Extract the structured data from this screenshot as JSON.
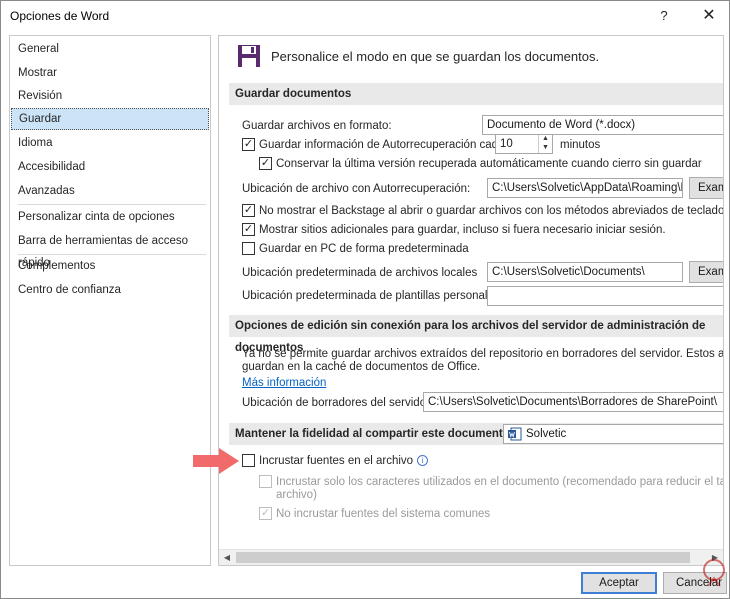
{
  "window": {
    "title": "Opciones de Word",
    "help_glyph": "?",
    "close_glyph": "✕"
  },
  "nav": {
    "items": [
      {
        "label": "General"
      },
      {
        "label": "Mostrar"
      },
      {
        "label": "Revisión"
      },
      {
        "label": "Guardar",
        "selected": true
      },
      {
        "label": "Idioma"
      },
      {
        "label": "Accesibilidad"
      },
      {
        "label": "Avanzadas"
      },
      {
        "label": "Personalizar cinta de opciones"
      },
      {
        "label": "Barra de herramientas de acceso rápido"
      },
      {
        "label": "Complementos"
      },
      {
        "label": "Centro de confianza"
      }
    ]
  },
  "main": {
    "header": {
      "icon": "save-disk-icon",
      "text": "Personalice el modo en que se guardan los documentos."
    },
    "save_section": {
      "title": "Guardar documentos",
      "format_label": "Guardar archivos en formato:",
      "format_value": "Documento de Word (*.docx)",
      "autorecover_label": "Guardar información de Autorrecuperación cada",
      "autorecover_minutes": "10",
      "minutes_label": "minutos",
      "keep_last_label": "Conservar la última versión recuperada automáticamente cuando cierro sin guardar",
      "autorecover_location_label": "Ubicación de archivo con Autorrecuperación:",
      "autorecover_location_value": "C:\\Users\\Solvetic\\AppData\\Roaming\\Mic",
      "browse_label": "Exam",
      "no_backstage_label": "No mostrar el Backstage al abrir o guardar archivos con los métodos abreviados de teclado",
      "show_places_label": "Mostrar sitios adicionales para guardar, incluso si fuera necesario iniciar sesión.",
      "save_pc_label": "Guardar en PC de forma predeterminada",
      "local_location_label": "Ubicación predeterminada de archivos locales",
      "local_location_value": "C:\\Users\\Solvetic\\Documents\\",
      "local_browse_label": "Exam",
      "templates_label": "Ubicación predeterminada de plantillas personales:",
      "templates_value": ""
    },
    "offline_section": {
      "title": "Opciones de edición sin conexión para los archivos del servidor de administración de documentos",
      "desc_line1": "Ya no se permite guardar archivos extraídos del repositorio en borradores del servidor. Estos archivos ahc",
      "desc_line2": "guardan en la caché de documentos de Office.",
      "more_info": "Más información",
      "drafts_label": "Ubicación de borradores del servidor:",
      "drafts_value": "C:\\Users\\Solvetic\\Documents\\Borradores de SharePoint\\"
    },
    "fidelity_section": {
      "title": "Mantener la fidelidad al compartir este documento:",
      "doc_name": "Solvetic",
      "doc_icon": "word-document-icon",
      "embed_fonts_label": "Incrustar fuentes en el archivo",
      "embed_used_chars_line1": "Incrustar solo los caracteres utilizados en el documento (recomendado para reducir el tamaño de",
      "embed_used_chars_line2": "archivo)",
      "no_system_fonts_label": "No incrustar fuentes del sistema comunes"
    }
  },
  "footer": {
    "accept_label": "Aceptar",
    "cancel_label": "Cancelar"
  },
  "colors": {
    "selected_nav": "#cce4f7",
    "link": "#0563c1",
    "section_bar": "#e9e9e9",
    "arrow": "#f26b6b"
  }
}
